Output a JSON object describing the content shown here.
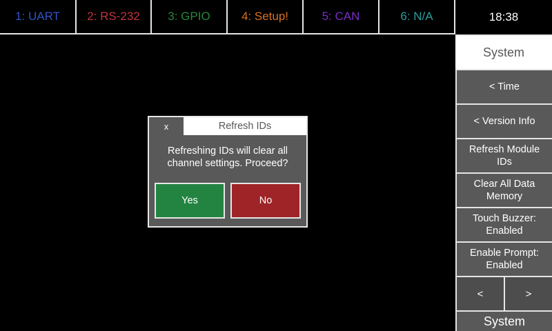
{
  "tabs": [
    {
      "label": "1: UART",
      "color": "#2f54c6"
    },
    {
      "label": "2: RS-232",
      "color": "#c2353c"
    },
    {
      "label": "3: GPIO",
      "color": "#28883c"
    },
    {
      "label": "4: Setup!",
      "color": "#d9701f"
    },
    {
      "label": "5: CAN",
      "color": "#7a2fc4"
    },
    {
      "label": "6: N/A",
      "color": "#2a9ea0"
    }
  ],
  "clock": "18:38",
  "sidebar": {
    "header": "System",
    "buttons": [
      {
        "label": "< Time"
      },
      {
        "label": "< Version Info"
      },
      {
        "label": "Refresh Module\nIDs"
      },
      {
        "label": "Clear All Data\nMemory"
      },
      {
        "label": "Touch Buzzer:\nEnabled"
      },
      {
        "label": "Enable Prompt:\nEnabled"
      }
    ],
    "prev_label": "<",
    "next_label": ">",
    "footer": "System"
  },
  "dialog": {
    "close_label": "x",
    "title": "Refresh IDs",
    "message": "Refreshing IDs will clear all\nchannel settings. Proceed?",
    "yes_label": "Yes",
    "no_label": "No"
  }
}
